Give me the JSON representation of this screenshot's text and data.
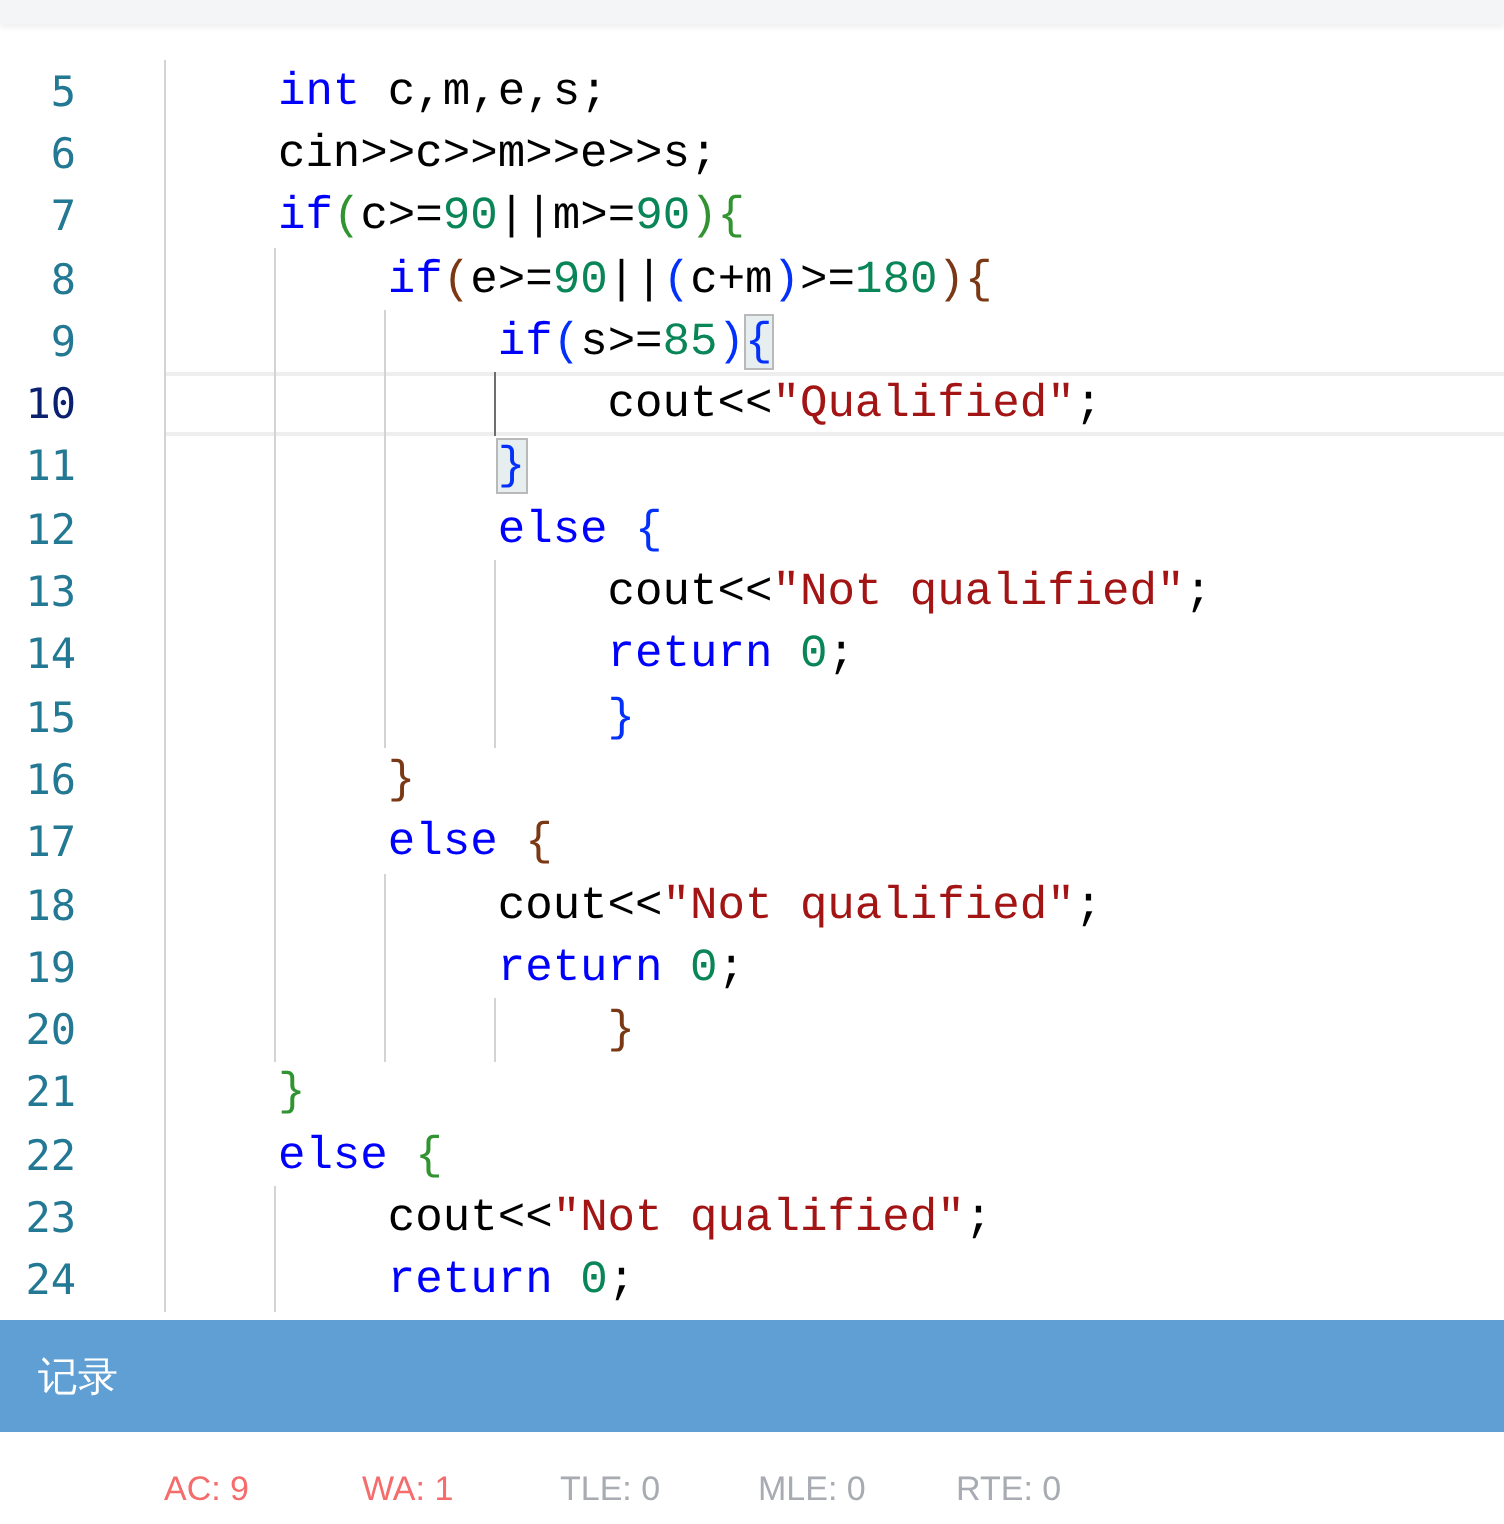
{
  "editor": {
    "lines": [
      {
        "number": "5",
        "current": false,
        "tokens": [
          {
            "text": "    int",
            "kind": "keyword"
          },
          {
            "text": " c,m,e,s;",
            "kind": "plain"
          }
        ]
      },
      {
        "number": "6",
        "current": false,
        "tokens": [
          {
            "text": "    cin>>c>>m>>e>>s;",
            "kind": "plain"
          }
        ]
      },
      {
        "number": "7",
        "current": false,
        "tokens": [
          {
            "text": "    if",
            "kind": "keyword"
          },
          {
            "text": "(",
            "kind": "bracket2"
          },
          {
            "text": "c>=",
            "kind": "plain"
          },
          {
            "text": "90",
            "kind": "number"
          },
          {
            "text": "||m>=",
            "kind": "plain"
          },
          {
            "text": "90",
            "kind": "number"
          },
          {
            "text": "){",
            "kind": "bracket2"
          }
        ]
      },
      {
        "number": "8",
        "current": false,
        "tokens": [
          {
            "text": "        if",
            "kind": "keyword"
          },
          {
            "text": "(",
            "kind": "bracket3"
          },
          {
            "text": "e>=",
            "kind": "plain"
          },
          {
            "text": "90",
            "kind": "number"
          },
          {
            "text": "||",
            "kind": "plain"
          },
          {
            "text": "(",
            "kind": "bracket1"
          },
          {
            "text": "c+m",
            "kind": "plain"
          },
          {
            "text": ")",
            "kind": "bracket1"
          },
          {
            "text": ">=",
            "kind": "plain"
          },
          {
            "text": "180",
            "kind": "number"
          },
          {
            "text": "){",
            "kind": "bracket3"
          }
        ]
      },
      {
        "number": "9",
        "current": false,
        "tokens": [
          {
            "text": "            if",
            "kind": "keyword"
          },
          {
            "text": "(",
            "kind": "bracket1"
          },
          {
            "text": "s>=",
            "kind": "plain"
          },
          {
            "text": "85",
            "kind": "number"
          },
          {
            "text": ")",
            "kind": "bracket1"
          },
          {
            "text": "{",
            "kind": "bracket1",
            "matched": true
          }
        ]
      },
      {
        "number": "10",
        "current": true,
        "tokens": [
          {
            "text": "                cout<<",
            "kind": "plain"
          },
          {
            "text": "\"Qualified\"",
            "kind": "string"
          },
          {
            "text": ";",
            "kind": "plain"
          }
        ]
      },
      {
        "number": "11",
        "current": false,
        "tokens": [
          {
            "text": "            }",
            "kind": "bracket1",
            "matched": true
          }
        ]
      },
      {
        "number": "12",
        "current": false,
        "tokens": [
          {
            "text": "            else",
            "kind": "keyword"
          },
          {
            "text": " {",
            "kind": "bracket1"
          }
        ]
      },
      {
        "number": "13",
        "current": false,
        "tokens": [
          {
            "text": "                cout<<",
            "kind": "plain"
          },
          {
            "text": "\"Not qualified\"",
            "kind": "string"
          },
          {
            "text": ";",
            "kind": "plain"
          }
        ]
      },
      {
        "number": "14",
        "current": false,
        "tokens": [
          {
            "text": "                return",
            "kind": "keyword"
          },
          {
            "text": " 0",
            "kind": "number"
          },
          {
            "text": ";",
            "kind": "plain"
          }
        ]
      },
      {
        "number": "15",
        "current": false,
        "tokens": [
          {
            "text": "                }",
            "kind": "bracket1"
          }
        ]
      },
      {
        "number": "16",
        "current": false,
        "tokens": [
          {
            "text": "        }",
            "kind": "bracket3"
          }
        ]
      },
      {
        "number": "17",
        "current": false,
        "tokens": [
          {
            "text": "        else",
            "kind": "keyword"
          },
          {
            "text": " {",
            "kind": "bracket3"
          }
        ]
      },
      {
        "number": "18",
        "current": false,
        "tokens": [
          {
            "text": "            cout<<",
            "kind": "plain"
          },
          {
            "text": "\"Not qualified\"",
            "kind": "string"
          },
          {
            "text": ";",
            "kind": "plain"
          }
        ]
      },
      {
        "number": "19",
        "current": false,
        "tokens": [
          {
            "text": "            return",
            "kind": "keyword"
          },
          {
            "text": " 0",
            "kind": "number"
          },
          {
            "text": ";",
            "kind": "plain"
          }
        ]
      },
      {
        "number": "20",
        "current": false,
        "tokens": [
          {
            "text": "                }",
            "kind": "bracket3"
          }
        ]
      },
      {
        "number": "21",
        "current": false,
        "tokens": [
          {
            "text": "    }",
            "kind": "bracket2"
          }
        ]
      },
      {
        "number": "22",
        "current": false,
        "tokens": [
          {
            "text": "    else",
            "kind": "keyword"
          },
          {
            "text": " {",
            "kind": "bracket2"
          }
        ]
      },
      {
        "number": "23",
        "current": false,
        "tokens": [
          {
            "text": "        cout<<",
            "kind": "plain"
          },
          {
            "text": "\"Not qualified\"",
            "kind": "string"
          },
          {
            "text": ";",
            "kind": "plain"
          }
        ]
      },
      {
        "number": "24",
        "current": false,
        "tokens": [
          {
            "text": "        return",
            "kind": "keyword"
          },
          {
            "text": " 0",
            "kind": "number"
          },
          {
            "text": ";",
            "kind": "plain"
          }
        ]
      }
    ]
  },
  "panel": {
    "title": "记录"
  },
  "results": [
    {
      "label": "AC: 9",
      "color": "#f56c6c"
    },
    {
      "label": "WA: 1",
      "color": "#f56c6c"
    },
    {
      "label": "TLE: 0",
      "color": "#a8abb2"
    },
    {
      "label": "MLE: 0",
      "color": "#a8abb2"
    },
    {
      "label": "RTE: 0",
      "color": "#a8abb2"
    }
  ]
}
